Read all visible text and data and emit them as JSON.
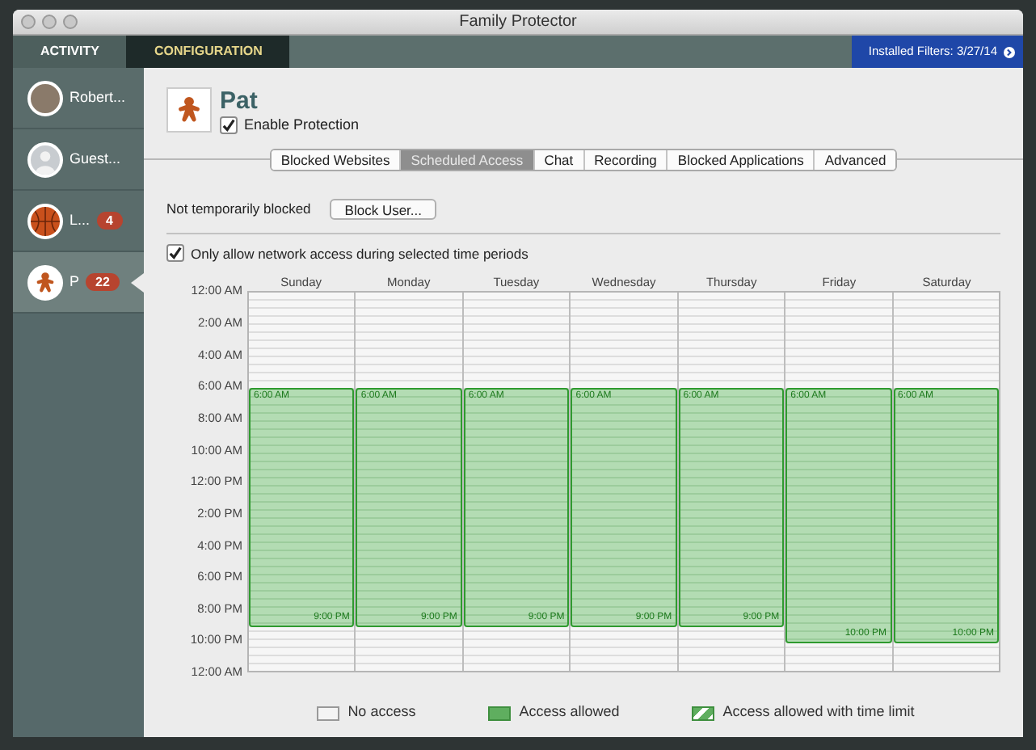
{
  "window": {
    "title": "Family Protector"
  },
  "main_tabs": [
    {
      "label": "ACTIVITY",
      "selected": false
    },
    {
      "label": "CONFIGURATION",
      "selected": true
    }
  ],
  "installed_filters": {
    "label": "Installed Filters: 3/27/14"
  },
  "sidebar": {
    "items": [
      {
        "kind": "photo",
        "name": "Robert...",
        "selected": false
      },
      {
        "kind": "guest",
        "name": "Guest...",
        "selected": false
      },
      {
        "kind": "ball",
        "name": "L...",
        "badge": "4",
        "selected": false
      },
      {
        "kind": "gingerbread",
        "name": "P",
        "badge": "22",
        "selected": true
      }
    ]
  },
  "profile": {
    "name": "Pat",
    "enable_protection": {
      "label": "Enable Protection",
      "checked": true
    }
  },
  "tabs": [
    {
      "label": "Blocked Websites",
      "selected": false
    },
    {
      "label": "Scheduled Access",
      "selected": true
    },
    {
      "label": "Chat",
      "selected": false
    },
    {
      "label": "Recording",
      "selected": false
    },
    {
      "label": "Blocked Applications",
      "selected": false
    },
    {
      "label": "Advanced",
      "selected": false
    }
  ],
  "block_status": {
    "text": "Not temporarily blocked",
    "button": "Block User..."
  },
  "only_allow": {
    "label": "Only allow network access during selected time periods",
    "checked": true
  },
  "schedule": {
    "time_labels": [
      "12:00 AM",
      "2:00 AM",
      "4:00 AM",
      "6:00 AM",
      "8:00 AM",
      "10:00 AM",
      "12:00 PM",
      "2:00 PM",
      "4:00 PM",
      "6:00 PM",
      "8:00 PM",
      "10:00 PM",
      "12:00 AM"
    ],
    "days": [
      {
        "name": "Sunday",
        "from": "6:00 AM",
        "to": "9:00 PM"
      },
      {
        "name": "Monday",
        "from": "6:00 AM",
        "to": "9:00 PM"
      },
      {
        "name": "Tuesday",
        "from": "6:00 AM",
        "to": "9:00 PM"
      },
      {
        "name": "Wednesday",
        "from": "6:00 AM",
        "to": "9:00 PM"
      },
      {
        "name": "Thursday",
        "from": "6:00 AM",
        "to": "9:00 PM"
      },
      {
        "name": "Friday",
        "from": "6:00 AM",
        "to": "10:00 PM"
      },
      {
        "name": "Saturday",
        "from": "6:00 AM",
        "to": "10:00 PM"
      }
    ]
  },
  "legend": [
    {
      "kind": "none",
      "label": "No access"
    },
    {
      "kind": "allowed",
      "label": "Access allowed"
    },
    {
      "kind": "limited",
      "label": "Access allowed with time limit"
    }
  ]
}
